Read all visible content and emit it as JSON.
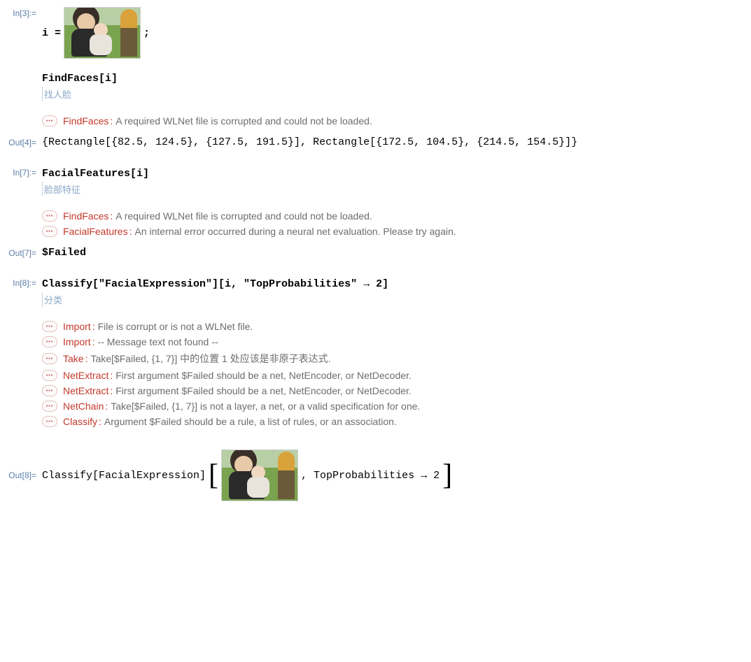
{
  "cells": {
    "in3": {
      "label": "In[3]:=",
      "code_prefix": "i = ",
      "code_suffix": ";",
      "code2": "FindFaces[i]",
      "annotation": "找人脸"
    },
    "msg1": {
      "tag": "FindFaces",
      "text": "A required WLNet file is corrupted and could not be loaded."
    },
    "out4": {
      "label": "Out[4]=",
      "value": "{Rectangle[{82.5, 124.5}, {127.5, 191.5}], Rectangle[{172.5, 104.5}, {214.5, 154.5}]}"
    },
    "in7": {
      "label": "In[7]:=",
      "code": "FacialFeatures[i]",
      "annotation": "脸部特征"
    },
    "msg2": {
      "tag": "FindFaces",
      "text": "A required WLNet file is corrupted and could not be loaded."
    },
    "msg3": {
      "tag": "FacialFeatures",
      "text": "An internal error occurred during a neural net evaluation. Please try again."
    },
    "out7": {
      "label": "Out[7]=",
      "value": "$Failed"
    },
    "in8": {
      "label": "In[8]:=",
      "code": "Classify[\"FacialExpression\"][i, \"TopProbabilities\" → 2]",
      "annotation": "分类"
    },
    "msg4": {
      "tag": "Import",
      "text": "File is corrupt or is not a WLNet file."
    },
    "msg5": {
      "tag": "Import",
      "text": "-- Message text not found --"
    },
    "msg6": {
      "tag": "Take",
      "text": "Take[$Failed, {1, 7}] 中的位置 1 处应该是非原子表达式."
    },
    "msg7": {
      "tag": "NetExtract",
      "text": "First argument $Failed should be a net, NetEncoder, or NetDecoder."
    },
    "msg8": {
      "tag": "NetExtract",
      "text": "First argument $Failed should be a net, NetEncoder, or NetDecoder."
    },
    "msg9": {
      "tag": "NetChain",
      "text": "Take[$Failed, {1, 7}] is not a layer, a net, or a valid specification for one."
    },
    "msg10": {
      "tag": "Classify",
      "text": "Argument $Failed should be a rule, a list of rules, or an association."
    },
    "out8": {
      "label": "Out[8]=",
      "prefix": "Classify[FacialExpression]",
      "mid": ", TopProbabilities → 2"
    }
  }
}
